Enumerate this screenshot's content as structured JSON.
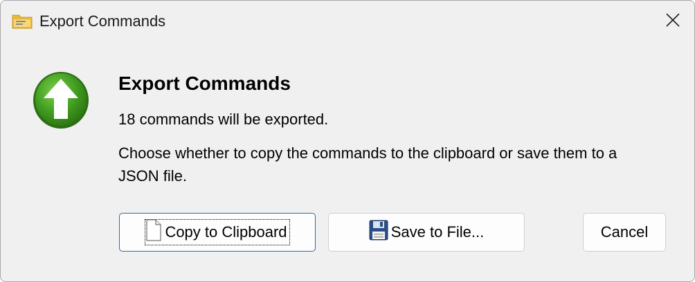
{
  "window": {
    "title": "Export Commands",
    "title_icon": "folder-icon",
    "close_icon": "close-icon"
  },
  "content": {
    "icon": "up-arrow-icon",
    "heading": "Export Commands",
    "count_message": "18 commands will be exported.",
    "instruction_line1": "Choose whether to copy the commands to the clipboard or save them to a",
    "instruction_line2": "JSON file."
  },
  "buttons": {
    "copy_label": "Copy to Clipboard",
    "copy_icon": "document-icon",
    "save_label": "Save to File...",
    "save_icon": "floppy-disk-icon",
    "cancel_label": "Cancel"
  },
  "colors": {
    "dialog_bg": "#f0f0f0",
    "focus_border": "#1f6fb5",
    "icon_green": "#3f9b1f"
  }
}
